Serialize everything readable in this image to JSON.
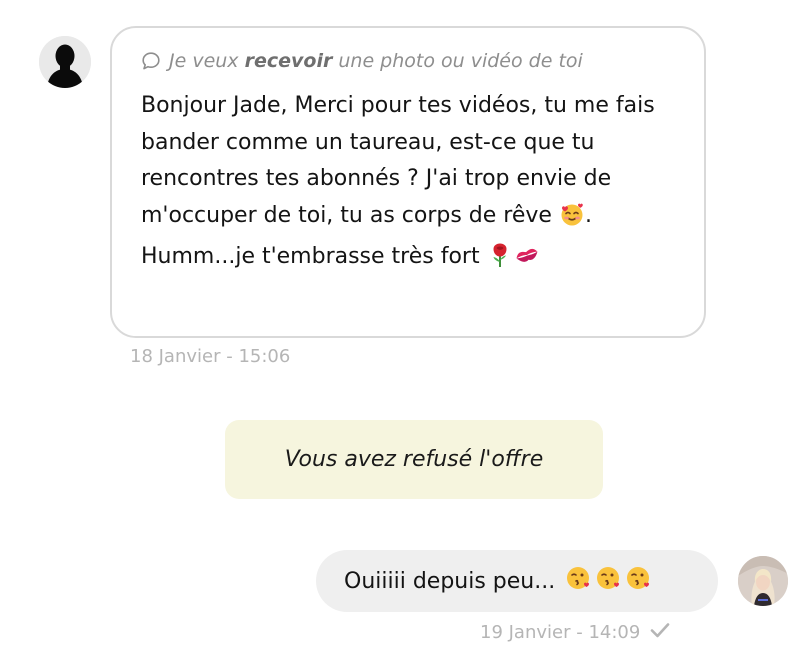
{
  "incoming": {
    "request_prefix": "Je veux ",
    "request_keyword": "recevoir",
    "request_suffix": " une photo ou vidéo de toi",
    "text_part1": "Bonjour Jade, Merci pour tes vidéos, tu me fais bander comme un taureau, est-ce que tu rencontres tes abonnés ? J'ai trop envie de m'occuper de toi, tu as corps de rêve ",
    "text_part2": ". Humm...je t'embrasse très fort ",
    "timestamp": "18 Janvier - 15:06",
    "emojis": [
      "smiling-face-with-hearts",
      "rose",
      "kiss-mark"
    ]
  },
  "system_notice": {
    "text": "Vous avez refusé l'offre",
    "background": "#f6f5de"
  },
  "outgoing": {
    "text": "Ouiiiii depuis peu...",
    "emojis": [
      "face-blowing-a-kiss",
      "face-blowing-a-kiss",
      "face-blowing-a-kiss"
    ],
    "timestamp": "19 Janvier - 14:09",
    "status_icon": "checkmark-icon"
  },
  "colors": {
    "bubble_border": "#d9d9d9",
    "outgoing_bubble": "#efefef",
    "meta_text": "#b5b5b5"
  }
}
